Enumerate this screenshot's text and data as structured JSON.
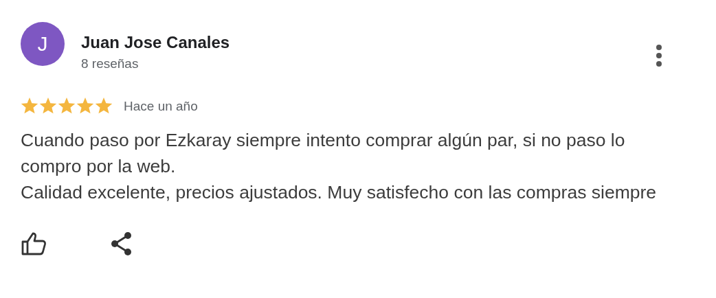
{
  "reviewer": {
    "initial": "J",
    "color": "#7e57c2",
    "name": "Juan Jose Canales",
    "review_count": "8 reseñas"
  },
  "review": {
    "stars": 5,
    "time": "Hace un año",
    "paragraphs": [
      "Cuando paso por Ezkaray siempre intento comprar algún par, si no paso lo compro por la web.",
      "Calidad excelente, precios ajustados. Muy satisfecho con las compras siempre"
    ]
  }
}
